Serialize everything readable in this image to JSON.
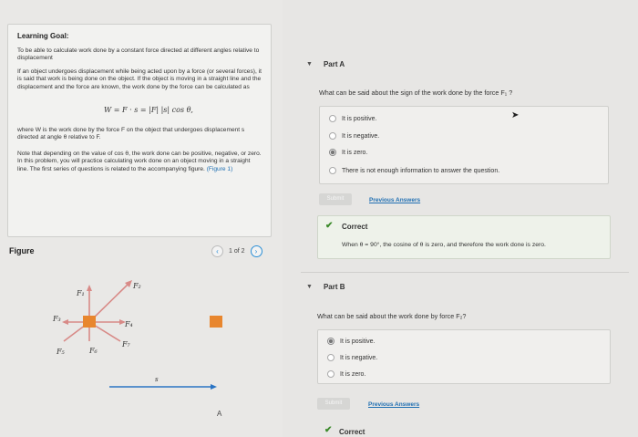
{
  "goal": {
    "title": "Learning Goal:",
    "intro": "To be able to calculate work done by a constant force directed at different angles relative to displacement",
    "para1": "If an object undergoes displacement while being acted upon by a force (or several forces), it is said that work is being done on the object. If the object is moving in a straight line and the displacement and the force are known, the work done by the force can be calculated as",
    "formula": "W = F · s = |F| |s| cos θ,",
    "para2": "where W is the work done by the force F on the object that undergoes displacement s directed at angle θ relative to F.",
    "para3": "Note that depending on the value of cos θ, the work done can be positive, negative, or zero.",
    "para4": "In this problem, you will practice calculating work done on an object moving in a straight line. The first series of questions is related to the accompanying figure.",
    "figure_link": "(Figure 1)"
  },
  "figure": {
    "title": "Figure",
    "pager": "1 of 2",
    "prev_icon": "chevron-left-icon",
    "next_icon": "chevron-right-icon",
    "labels": {
      "F1": "F₁",
      "F2": "F₂",
      "F3": "F₃",
      "F4": "F₄",
      "F5": "F₅",
      "F6": "F₆",
      "F7": "F₇",
      "s": "s",
      "A": "A"
    },
    "colors": {
      "block": "#e8862e",
      "arrow": "#2a74c4"
    }
  },
  "partA": {
    "header": "Part A",
    "question": "What can be said about the sign of the work done by the force F₁ ?",
    "options": [
      "It is positive.",
      "It is negative.",
      "It is zero.",
      "There is not enough information to answer the question."
    ],
    "selected": 2,
    "submit": "Submit",
    "previous": "Previous Answers",
    "result": "Correct",
    "feedback": "When θ = 90°, the cosine of θ is zero, and therefore the work done is zero."
  },
  "partB": {
    "header": "Part B",
    "question": "What can be said about the work done by force F₂?",
    "options": [
      "It is positive.",
      "It is negative.",
      "It is zero."
    ],
    "selected": 0,
    "submit": "Submit",
    "previous": "Previous Answers",
    "result": "Correct"
  }
}
